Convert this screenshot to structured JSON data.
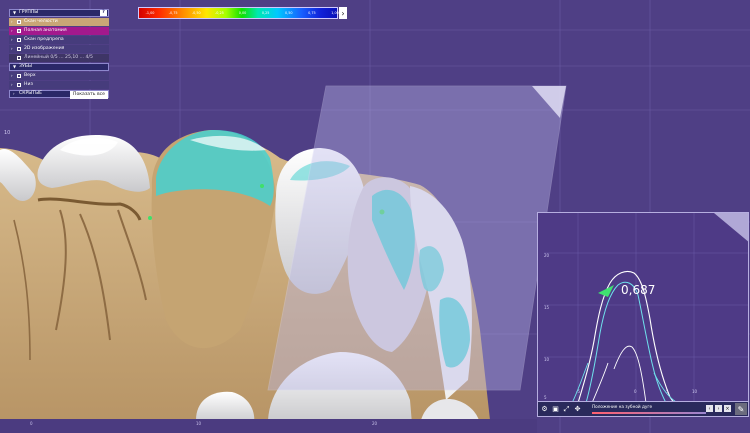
{
  "layer_panel": {
    "groups_header": "ГРУППЫ",
    "groups": [
      {
        "label": "Скан челюсти",
        "checked": true
      },
      {
        "label": "Полная анатомия",
        "checked": true
      },
      {
        "label": "Скан предпрепа",
        "checked": false
      },
      {
        "label": "2D изображения",
        "checked": false
      },
      {
        "label": "Линейный 0/5 ... 25,10 ... 4/5",
        "checked": false
      }
    ],
    "teeth_header": "ЗУБЫ",
    "teeth": [
      {
        "label": "Верх",
        "checked": false
      },
      {
        "label": "Низ",
        "checked": false
      }
    ],
    "hidden_header": "СКРЫТЫЕ",
    "show_all": "Показать все",
    "help": "?"
  },
  "color_scale": {
    "arrow": "›",
    "labels": [
      "-1,00",
      "-0,75",
      "-0,50",
      "-0,25",
      "0,00",
      "0,25",
      "0,50",
      "0,75",
      "1,00"
    ]
  },
  "inset": {
    "value": "0,687",
    "slider_label": "Положение на зубной дуге",
    "axis_y_labels": [
      "20",
      "15",
      "10",
      "5"
    ],
    "axis_x_labels": [
      "-5",
      "0",
      "5",
      "10"
    ]
  },
  "ruler_labels": [
    "0",
    "10",
    "20"
  ],
  "side_labels": [
    "10",
    "20"
  ],
  "colors": {
    "background": "#4f3f85",
    "tooth_tan": "#c8a878",
    "enamel_white": "#eeeeee",
    "distance_cyan": "#49d6d6",
    "section_plane": "#b9b6e8"
  }
}
